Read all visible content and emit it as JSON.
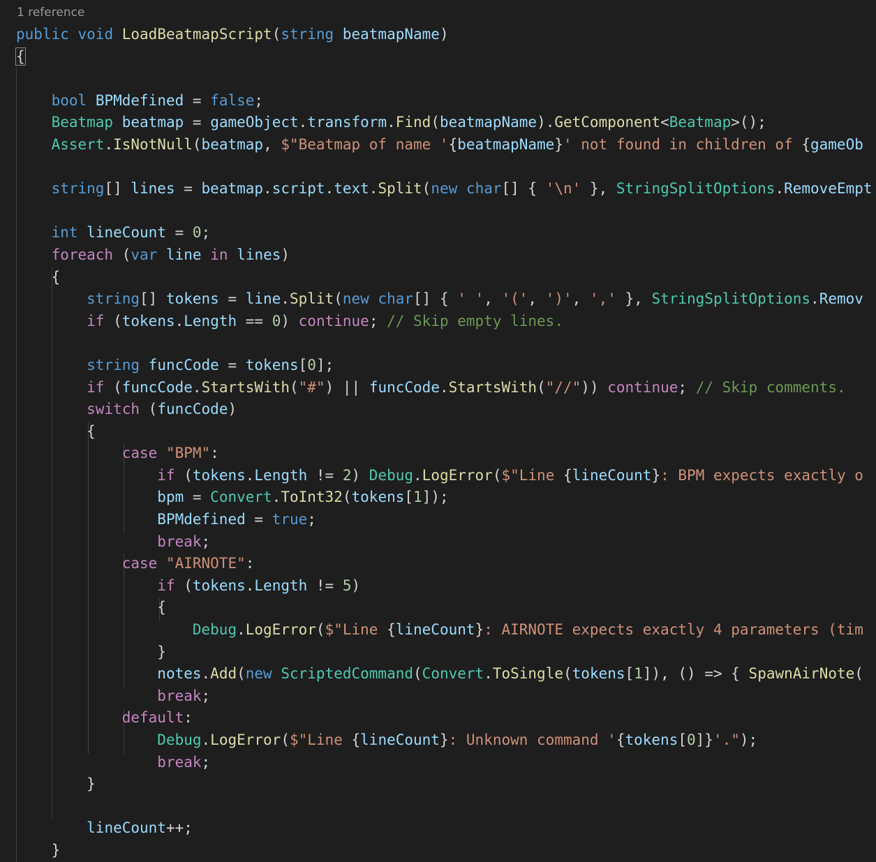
{
  "codelens": {
    "references": "1 reference"
  },
  "theme": {
    "background": "#1e1e1e",
    "keyword": "#569cd6",
    "control": "#c586c0",
    "type": "#4ec9b0",
    "function": "#dcdcaa",
    "identifier": "#9cdcfe",
    "string": "#ce9178",
    "number": "#b5cea8",
    "comment": "#6a9955",
    "plain": "#d4d4d4"
  },
  "editor": {
    "lines": [
      [
        [
          "kw",
          "public"
        ],
        [
          "op",
          " "
        ],
        [
          "kw",
          "void"
        ],
        [
          "op",
          " "
        ],
        [
          "fn",
          "LoadBeatmapScript"
        ],
        [
          "op",
          "("
        ],
        [
          "kw",
          "string"
        ],
        [
          "op",
          " "
        ],
        [
          "id",
          "beatmapName"
        ],
        [
          "op",
          ")"
        ]
      ],
      [
        [
          "op",
          "{"
        ]
      ],
      [],
      [
        [
          "op",
          "    "
        ],
        [
          "kw",
          "bool"
        ],
        [
          "op",
          " "
        ],
        [
          "id",
          "BPMdefined"
        ],
        [
          "op",
          " = "
        ],
        [
          "kw",
          "false"
        ],
        [
          "op",
          ";"
        ]
      ],
      [
        [
          "op",
          "    "
        ],
        [
          "ty",
          "Beatmap"
        ],
        [
          "op",
          " "
        ],
        [
          "id",
          "beatmap"
        ],
        [
          "op",
          " = "
        ],
        [
          "id",
          "gameObject"
        ],
        [
          "op",
          "."
        ],
        [
          "id",
          "transform"
        ],
        [
          "op",
          "."
        ],
        [
          "fn",
          "Find"
        ],
        [
          "op",
          "("
        ],
        [
          "id",
          "beatmapName"
        ],
        [
          "op",
          ")."
        ],
        [
          "fn",
          "GetComponent"
        ],
        [
          "op",
          "<"
        ],
        [
          "ty",
          "Beatmap"
        ],
        [
          "op",
          ">();"
        ]
      ],
      [
        [
          "op",
          "    "
        ],
        [
          "ty",
          "Assert"
        ],
        [
          "op",
          "."
        ],
        [
          "fn",
          "IsNotNull"
        ],
        [
          "op",
          "("
        ],
        [
          "id",
          "beatmap"
        ],
        [
          "op",
          ", "
        ],
        [
          "st",
          "$\"Beatmap of name '"
        ],
        [
          "op",
          "{"
        ],
        [
          "id",
          "beatmapName"
        ],
        [
          "op",
          "}"
        ],
        [
          "st",
          "' not found in children of "
        ],
        [
          "op",
          "{"
        ],
        [
          "id",
          "gameOb"
        ]
      ],
      [],
      [
        [
          "op",
          "    "
        ],
        [
          "kw",
          "string"
        ],
        [
          "op",
          "[] "
        ],
        [
          "id",
          "lines"
        ],
        [
          "op",
          " = "
        ],
        [
          "id",
          "beatmap"
        ],
        [
          "op",
          "."
        ],
        [
          "id",
          "script"
        ],
        [
          "op",
          "."
        ],
        [
          "id",
          "text"
        ],
        [
          "op",
          "."
        ],
        [
          "fn",
          "Split"
        ],
        [
          "op",
          "("
        ],
        [
          "kw",
          "new"
        ],
        [
          "op",
          " "
        ],
        [
          "kw",
          "char"
        ],
        [
          "op",
          "[] { "
        ],
        [
          "st",
          "'\\n'"
        ],
        [
          "op",
          " }, "
        ],
        [
          "ty",
          "StringSplitOptions"
        ],
        [
          "op",
          "."
        ],
        [
          "id",
          "RemoveEmpt"
        ]
      ],
      [],
      [
        [
          "op",
          "    "
        ],
        [
          "kw",
          "int"
        ],
        [
          "op",
          " "
        ],
        [
          "id",
          "lineCount"
        ],
        [
          "op",
          " = "
        ],
        [
          "nu",
          "0"
        ],
        [
          "op",
          ";"
        ]
      ],
      [
        [
          "op",
          "    "
        ],
        [
          "ctl",
          "foreach"
        ],
        [
          "op",
          " ("
        ],
        [
          "kw",
          "var"
        ],
        [
          "op",
          " "
        ],
        [
          "id",
          "line"
        ],
        [
          "op",
          " "
        ],
        [
          "ctl",
          "in"
        ],
        [
          "op",
          " "
        ],
        [
          "id",
          "lines"
        ],
        [
          "op",
          ")"
        ]
      ],
      [
        [
          "op",
          "    {"
        ]
      ],
      [
        [
          "op",
          "        "
        ],
        [
          "kw",
          "string"
        ],
        [
          "op",
          "[] "
        ],
        [
          "id",
          "tokens"
        ],
        [
          "op",
          " = "
        ],
        [
          "id",
          "line"
        ],
        [
          "op",
          "."
        ],
        [
          "fn",
          "Split"
        ],
        [
          "op",
          "("
        ],
        [
          "kw",
          "new"
        ],
        [
          "op",
          " "
        ],
        [
          "kw",
          "char"
        ],
        [
          "op",
          "[] { "
        ],
        [
          "st",
          "' '"
        ],
        [
          "op",
          ", "
        ],
        [
          "st",
          "'('"
        ],
        [
          "op",
          ", "
        ],
        [
          "st",
          "')'"
        ],
        [
          "op",
          ", "
        ],
        [
          "st",
          "','"
        ],
        [
          "op",
          " }, "
        ],
        [
          "ty",
          "StringSplitOptions"
        ],
        [
          "op",
          "."
        ],
        [
          "id",
          "Remov"
        ]
      ],
      [
        [
          "op",
          "        "
        ],
        [
          "ctl",
          "if"
        ],
        [
          "op",
          " ("
        ],
        [
          "id",
          "tokens"
        ],
        [
          "op",
          "."
        ],
        [
          "id",
          "Length"
        ],
        [
          "op",
          " == "
        ],
        [
          "nu",
          "0"
        ],
        [
          "op",
          ") "
        ],
        [
          "ctl",
          "continue"
        ],
        [
          "op",
          "; "
        ],
        [
          "cm",
          "// Skip empty lines."
        ]
      ],
      [],
      [
        [
          "op",
          "        "
        ],
        [
          "kw",
          "string"
        ],
        [
          "op",
          " "
        ],
        [
          "id",
          "funcCode"
        ],
        [
          "op",
          " = "
        ],
        [
          "id",
          "tokens"
        ],
        [
          "op",
          "["
        ],
        [
          "nu",
          "0"
        ],
        [
          "op",
          "];"
        ]
      ],
      [
        [
          "op",
          "        "
        ],
        [
          "ctl",
          "if"
        ],
        [
          "op",
          " ("
        ],
        [
          "id",
          "funcCode"
        ],
        [
          "op",
          "."
        ],
        [
          "fn",
          "StartsWith"
        ],
        [
          "op",
          "("
        ],
        [
          "st",
          "\"#\""
        ],
        [
          "op",
          ") || "
        ],
        [
          "id",
          "funcCode"
        ],
        [
          "op",
          "."
        ],
        [
          "fn",
          "StartsWith"
        ],
        [
          "op",
          "("
        ],
        [
          "st",
          "\"//\""
        ],
        [
          "op",
          ")) "
        ],
        [
          "ctl",
          "continue"
        ],
        [
          "op",
          "; "
        ],
        [
          "cm",
          "// Skip comments."
        ]
      ],
      [
        [
          "op",
          "        "
        ],
        [
          "ctl",
          "switch"
        ],
        [
          "op",
          " ("
        ],
        [
          "id",
          "funcCode"
        ],
        [
          "op",
          ")"
        ]
      ],
      [
        [
          "op",
          "        {"
        ]
      ],
      [
        [
          "op",
          "            "
        ],
        [
          "ctl",
          "case"
        ],
        [
          "op",
          " "
        ],
        [
          "st",
          "\"BPM\""
        ],
        [
          "op",
          ":"
        ]
      ],
      [
        [
          "op",
          "                "
        ],
        [
          "ctl",
          "if"
        ],
        [
          "op",
          " ("
        ],
        [
          "id",
          "tokens"
        ],
        [
          "op",
          "."
        ],
        [
          "id",
          "Length"
        ],
        [
          "op",
          " != "
        ],
        [
          "nu",
          "2"
        ],
        [
          "op",
          ") "
        ],
        [
          "ty",
          "Debug"
        ],
        [
          "op",
          "."
        ],
        [
          "fn",
          "LogError"
        ],
        [
          "op",
          "("
        ],
        [
          "st",
          "$\"Line "
        ],
        [
          "op",
          "{"
        ],
        [
          "id",
          "lineCount"
        ],
        [
          "op",
          "}"
        ],
        [
          "st",
          ": BPM expects exactly o"
        ]
      ],
      [
        [
          "op",
          "                "
        ],
        [
          "id",
          "bpm"
        ],
        [
          "op",
          " = "
        ],
        [
          "ty",
          "Convert"
        ],
        [
          "op",
          "."
        ],
        [
          "fn",
          "ToInt32"
        ],
        [
          "op",
          "("
        ],
        [
          "id",
          "tokens"
        ],
        [
          "op",
          "["
        ],
        [
          "nu",
          "1"
        ],
        [
          "op",
          "]);"
        ]
      ],
      [
        [
          "op",
          "                "
        ],
        [
          "id",
          "BPMdefined"
        ],
        [
          "op",
          " = "
        ],
        [
          "kw",
          "true"
        ],
        [
          "op",
          ";"
        ]
      ],
      [
        [
          "op",
          "                "
        ],
        [
          "ctl",
          "break"
        ],
        [
          "op",
          ";"
        ]
      ],
      [
        [
          "op",
          "            "
        ],
        [
          "ctl",
          "case"
        ],
        [
          "op",
          " "
        ],
        [
          "st",
          "\"AIRNOTE\""
        ],
        [
          "op",
          ":"
        ]
      ],
      [
        [
          "op",
          "                "
        ],
        [
          "ctl",
          "if"
        ],
        [
          "op",
          " ("
        ],
        [
          "id",
          "tokens"
        ],
        [
          "op",
          "."
        ],
        [
          "id",
          "Length"
        ],
        [
          "op",
          " != "
        ],
        [
          "nu",
          "5"
        ],
        [
          "op",
          ")"
        ]
      ],
      [
        [
          "op",
          "                {"
        ]
      ],
      [
        [
          "op",
          "                    "
        ],
        [
          "ty",
          "Debug"
        ],
        [
          "op",
          "."
        ],
        [
          "fn",
          "LogError"
        ],
        [
          "op",
          "("
        ],
        [
          "st",
          "$\"Line "
        ],
        [
          "op",
          "{"
        ],
        [
          "id",
          "lineCount"
        ],
        [
          "op",
          "}"
        ],
        [
          "st",
          ": AIRNOTE expects exactly 4 parameters (tim"
        ]
      ],
      [
        [
          "op",
          "                }"
        ]
      ],
      [
        [
          "op",
          "                "
        ],
        [
          "id",
          "notes"
        ],
        [
          "op",
          "."
        ],
        [
          "fn",
          "Add"
        ],
        [
          "op",
          "("
        ],
        [
          "kw",
          "new"
        ],
        [
          "op",
          " "
        ],
        [
          "ty",
          "ScriptedCommand"
        ],
        [
          "op",
          "("
        ],
        [
          "ty",
          "Convert"
        ],
        [
          "op",
          "."
        ],
        [
          "fn",
          "ToSingle"
        ],
        [
          "op",
          "("
        ],
        [
          "id",
          "tokens"
        ],
        [
          "op",
          "["
        ],
        [
          "nu",
          "1"
        ],
        [
          "op",
          "]), () => { "
        ],
        [
          "fn",
          "SpawnAirNote"
        ],
        [
          "op",
          "("
        ]
      ],
      [
        [
          "op",
          "                "
        ],
        [
          "ctl",
          "break"
        ],
        [
          "op",
          ";"
        ]
      ],
      [
        [
          "op",
          "            "
        ],
        [
          "ctl",
          "default"
        ],
        [
          "op",
          ":"
        ]
      ],
      [
        [
          "op",
          "                "
        ],
        [
          "ty",
          "Debug"
        ],
        [
          "op",
          "."
        ],
        [
          "fn",
          "LogError"
        ],
        [
          "op",
          "("
        ],
        [
          "st",
          "$\"Line "
        ],
        [
          "op",
          "{"
        ],
        [
          "id",
          "lineCount"
        ],
        [
          "op",
          "}"
        ],
        [
          "st",
          ": Unknown command '"
        ],
        [
          "op",
          "{"
        ],
        [
          "id",
          "tokens"
        ],
        [
          "op",
          "["
        ],
        [
          "nu",
          "0"
        ],
        [
          "op",
          "]}"
        ],
        [
          "st",
          "'.\""
        ],
        [
          "op",
          ");"
        ]
      ],
      [
        [
          "op",
          "                "
        ],
        [
          "ctl",
          "break"
        ],
        [
          "op",
          ";"
        ]
      ],
      [
        [
          "op",
          "        }"
        ]
      ],
      [],
      [
        [
          "op",
          "        "
        ],
        [
          "id",
          "lineCount"
        ],
        [
          "op",
          "++;"
        ]
      ],
      [
        [
          "op",
          "    }"
        ]
      ],
      []
    ]
  }
}
